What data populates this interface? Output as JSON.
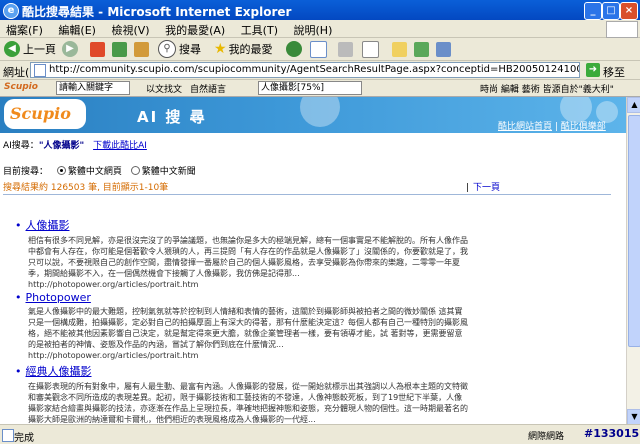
{
  "window": {
    "title": "酷比搜尋結果 - Microsoft Internet Explorer",
    "ie_icon": "e"
  },
  "menu": [
    "檔案(F)",
    "編輯(E)",
    "檢視(V)",
    "我的最愛(A)",
    "工具(T)",
    "說明(H)"
  ],
  "toolbar": {
    "back": "上一頁",
    "search": "搜尋",
    "favorites": "我的最愛"
  },
  "address": {
    "label": "網址(D)",
    "url": "http://community.scupio.com/scupiocommunity/AgentSearchResultPage.aspx?conceptid=HB20050124100136435420050613170",
    "go": "移至"
  },
  "links_bar": {
    "brand": "Scupio",
    "dropdown1": "請輸入關鍵字",
    "item1": "以文找文",
    "item2": "自然語言",
    "dropdown2": "人像攝影[75%]",
    "item3": "時尚 編輯 藝術 皆源自於\"義大利\""
  },
  "banner": {
    "logo": "Scupio",
    "title": "AI 搜 尋",
    "link1": "酷比網站首頁",
    "link2": "酷比俱樂部"
  },
  "ai_line": {
    "prefix": "AI搜尋：",
    "keyword": "\"人像攝影\"",
    "download": "下載此酷比AI"
  },
  "scope": {
    "label": "目前搜尋：",
    "option1": "繁體中文網頁",
    "option2": "繁體中文新聞"
  },
  "summary": "搜尋結果約 126503 筆, 目前顯示1-10筆",
  "nextpage": "下一頁",
  "results": [
    {
      "title": "人像攝影",
      "snippet": "相信有很多不同見解，亦是很沒完沒了的爭論議題，也無論你是多大的極端見解，總有一個事實是不能解脫的。所有人像作品中都會有人存在，你可能是個著歡令人猥瑣的人，再三提問「有人存在的作品就是人像攝影了」沒關係的，你要歡就是了，我只可以說，不要視限自己的創作空間，盡情發揮一番屬於自己的個人攝影風格，去享受攝影為你帶來的樂趣，二零零一年夏季，期間給攝影不入，在一個偶然機會下接觸了人像攝影，我仿佛是記得那...",
      "url": "http://photopower.org/articles/portrait.htm"
    },
    {
      "title": "Photopower",
      "snippet": "氣是人像攝影中的最大難題，控制氣氛就等於控制到人情緒和表情的藝術，這關於到攝影師與被拍者之間的微妙關係 這其實只是一個構成難，拍攝攝影，定必對自己的拍攝厚面上有深大的得著，那有什麼能決定這？每個人都有自己一種特別的攝影風格，絕不能被其他因素影響自己決定，就是幫定得來更大膽，就像企業管理者一樣，要有領導才能，試 著對等，更需要留意的是被拍者的神情、姿態及作品的內涵，嘗試了解你們到底在什麼情況...",
      "url": "http://photopower.org/articles/portrait.htm"
    },
    {
      "title": "經典人像攝影",
      "snippet": "在攝影表現的所有對象中，屬有人最生動、最富有內涵。人像攝影的發展，從一開始就標示出其強調以人為根本主題的文特徵和審美觀念不同所造成的表現差異。起初，限于攝影技術和工藝技術的不發達，人像神態較死板，到了19世紀下半葉，人像攝影家結合繪畫與攝影的技法，亦逐漸在作品上呈現拉長，準確地把握神態和姿態，充分體現人物的個性。這一時期最著名的攝影大師是歐洲的納達爾和卡爾札，他們相近的表現風格成為人像攝影的一代經...",
      "url": ""
    }
  ],
  "statusbar": {
    "done": "完成",
    "zone": "網際網路",
    "number": "#133015"
  }
}
